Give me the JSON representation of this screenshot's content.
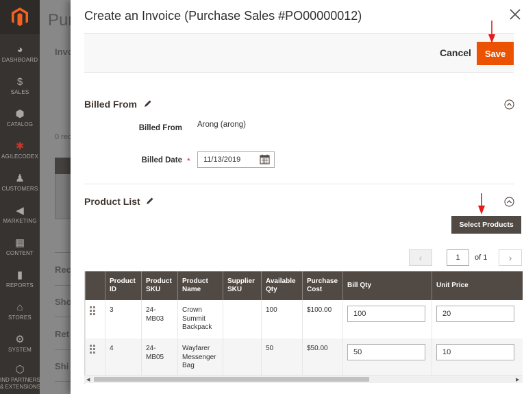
{
  "sidebar": {
    "items": [
      {
        "label": "DASHBOARD",
        "icon": "dashboard-icon",
        "glyph": "◕"
      },
      {
        "label": "SALES",
        "icon": "dollar-icon",
        "glyph": "$"
      },
      {
        "label": "CATALOG",
        "icon": "cube-icon",
        "glyph": "⬢"
      },
      {
        "label": "AGILECODEX",
        "icon": "agilecodex-icon",
        "glyph": "✱"
      },
      {
        "label": "CUSTOMERS",
        "icon": "person-icon",
        "glyph": "♟"
      },
      {
        "label": "MARKETING",
        "icon": "megaphone-icon",
        "glyph": "◀"
      },
      {
        "label": "CONTENT",
        "icon": "content-icon",
        "glyph": "▦"
      },
      {
        "label": "REPORTS",
        "icon": "bar-chart-icon",
        "glyph": "▮"
      },
      {
        "label": "STORES",
        "icon": "store-icon",
        "glyph": "⌂"
      },
      {
        "label": "SYSTEM",
        "icon": "gear-icon",
        "glyph": "⚙"
      }
    ],
    "last_item": {
      "label_line1": "IND PARTNERS",
      "label_line2": "& EXTENSIONS",
      "icon": "extensions-icon",
      "glyph": "⬡"
    }
  },
  "background_page": {
    "title": "Pur",
    "section1": "Invo",
    "records": "0 rec",
    "items": [
      "Rec",
      "Sho",
      "Ret",
      "Shi"
    ]
  },
  "modal": {
    "title": "Create an Invoice (Purchase Sales #PO00000012)",
    "cancel_label": "Cancel",
    "save_label": "Save",
    "billed_from_section": {
      "title": "Billed From",
      "billed_from_label": "Billed From",
      "billed_from_value": "Arong (arong)",
      "billed_date_label": "Billed Date",
      "billed_date_required": "*",
      "billed_date_value": "11/13/2019"
    },
    "product_list_section": {
      "title": "Product List",
      "select_products_label": "Select Products",
      "pager": {
        "current_page": "1",
        "of_label": "of 1"
      }
    },
    "grid": {
      "columns": [
        "",
        "Product ID",
        "Product SKU",
        "Product Name",
        "Supplier SKU",
        "Available Qty",
        "Purchase Cost",
        "Bill Qty",
        "Unit Price"
      ],
      "rows": [
        {
          "product_id": "3",
          "sku": "24-MB03",
          "name": "Crown Summit Backpack",
          "supplier_sku": "",
          "available_qty": "100",
          "purchase_cost": "$100.00",
          "bill_qty": "100",
          "unit_price": "20"
        },
        {
          "product_id": "4",
          "sku": "24-MB05",
          "name": "Wayfarer Messenger Bag",
          "supplier_sku": "",
          "available_qty": "50",
          "purchase_cost": "$50.00",
          "bill_qty": "50",
          "unit_price": "10"
        }
      ]
    }
  },
  "colors": {
    "accent": "#eb5202",
    "sidebar": "#373330",
    "grid_header": "#514943",
    "annotation_arrow": "#e41b1b"
  }
}
